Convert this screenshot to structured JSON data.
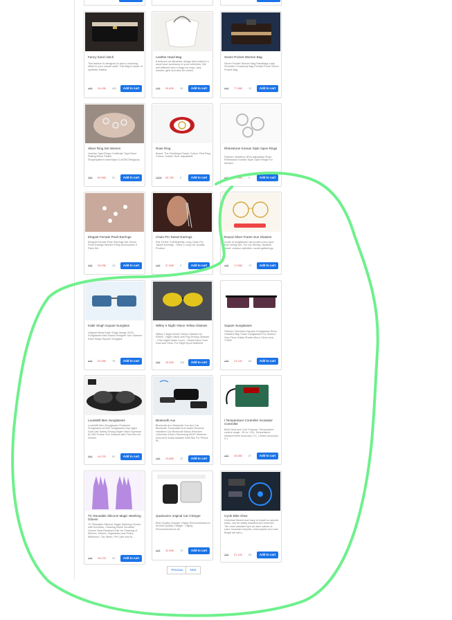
{
  "add_label": "Add to cart",
  "pagination": {
    "previous": "Previous",
    "next": "Next"
  },
  "products": [
    {
      "title": "Fancy hand clutch",
      "desc": "This fashion is designed to add a charming effect to your casual outfit. This Bag is made of synthetic leather.",
      "old": "44$",
      "new": "39.43$",
      "disc": "401"
    },
    {
      "title": "Leather Hand Bag",
      "desc": "It features an attractive design that makes it a must have accessory in your collection. We sell different kind of bags for boys, kids, women, girls and also for unisex.",
      "old": "77$",
      "new": "50.62$",
      "disc": "43"
    },
    {
      "title": "Seven Pocket Women Bag",
      "desc": "Seven Pocket Women Bag Handbags Lady Shoulder Crossbody Bag Female Purse Seven Pocket Bag",
      "old": "84$",
      "new": "77.98$",
      "disc": "13"
    },
    {
      "title": "Silver Ring Set Women",
      "desc": "Jewelry Type:Rings Certificate Type:None Plating:Silver Plated Shape\\pattern:noneStyle:CLASSICReligious",
      "old": "79$",
      "new": "60.58$",
      "disc": "51"
    },
    {
      "title": "Rose Ring",
      "desc": "Brand: The Greetings Flower Colour: Red Ring Colour: Golden Size: Adjustable",
      "old": "100$",
      "new": "96.76$",
      "disc": "9"
    },
    {
      "title": "Rhinestone Korean Style Open Rings",
      "desc": "Fashion Jewellery 3Pcs Adjustable Rose Rhinestone Korean Style Open Rings For Women",
      "old": "40$",
      "new": "27.58$",
      "disc": "9"
    },
    {
      "title": "Elegant Female Pearl Earrings",
      "desc": "Elegant Female Pearl Earrings Set Zircon Pearl Earings Women Party Accessories 9 Pairs Set",
      "old": "39$",
      "new": "26.93$",
      "disc": "16"
    },
    {
      "title": "Chain Pin Tassel Earrings",
      "desc": "Pair Of Ear Cuff Butterfly Long Chain Pin Tassel Earrings - Silver | Long Life Quality Product",
      "old": "45$",
      "new": "37.05$",
      "disc": "9"
    },
    {
      "title": "Round Silver Frame Sun Glasses",
      "desc": "A pair of sunglasses can protect your eyes from being hurt. For car driving, vacation travel, outdoor activities, social gatherings,",
      "old": "44$",
      "new": "17.98$",
      "disc": "79"
    },
    {
      "title": "Kabir Singh Square Sunglass",
      "desc": "Original Metal Kabir Singh design 2020 Sunglasses Men Brand Designer Sun Glasses Kabir Singh Square Sunglass",
      "old": "50$",
      "new": "42.28$",
      "disc": "78"
    },
    {
      "title": "Willey X Night Vision Yellow Glasses",
      "desc": "Willey X Night Vision Yellow Glasses for Riders - Night Vision Anti Fog Driving Glasses - Free Night Glass Cover - Shield Eyes From Dust and Virus- For Night Sport Matches",
      "old": "35$",
      "new": "28.30$",
      "disc": "115"
    },
    {
      "title": "Square Sunglasses",
      "desc": "Fashion Oversized Square Sunglasses Retro Gradient Big Frame Sunglasses For Women One Piece Gafas Shade Mirror Clear Lens 17059",
      "old": "28$",
      "new": "24.11$",
      "disc": "64"
    },
    {
      "title": "LouisWill Men Sunglasses",
      "desc": "LouisWill Men Sunglasses Polarized Sunglasses UV400 Sunglasses Day Night Dual Use Safety Driving Night Vision Eyewear AL-MG Frame Sun Glasses with Free Box for Drivers",
      "old": "50$",
      "new": "44.37$",
      "disc": "92"
    },
    {
      "title": "Bluetooth Aux",
      "desc": "Bluetooth Aux Bluetooth Car Aux Car Bluetooth Transmitter Aux Audio Receiver Handfree Car Bluetooth Music Receiver Universal 3.5mm Streaming A2DP Wireless Auto AUX Audio Adapter With Mic For Phone M...",
      "old": "25$",
      "new": "23.88$",
      "disc": "22"
    },
    {
      "title": "t Temperature Controller Incubator Controller",
      "desc": "Both Heat and Cool Purpose, Temperature control range: -50 to +110, Temperature measurement accuracy: 0.1, Control accuracy: 0.1",
      "old": "46$",
      "new": "35.08$",
      "disc": "57"
    },
    {
      "title": "TC Reusable Silicone Magic Washing Gloves",
      "desc": "TC Reusable Silicone Magic Washing Gloves with Scrubber, Cleaning Brush Scrubber Gloves Heat Resistant Pair for Cleaning of Kitchen, Dishes, Vegetables and Fruits, Bathroom, Car Wash, Pet Care and M...",
      "old": "29$",
      "new": "30.07$",
      "disc": "42"
    },
    {
      "title": "Qualcomm original Car Charger",
      "desc": "Best Quality Charger, Highly Recommended to all best Quality Charger , Highly Recommended to all",
      "old": "40$",
      "new": "32.99$",
      "disc": "79"
    },
    {
      "title": "Cycle Bike Glow",
      "desc": "Universal fitment and easy to install no special wires, can be easily installed and removed. Tire most standard tyre air stem valves of road, mountain bicycles, motorcycles and cars Bright led will s...",
      "old": "35$",
      "new": "31.12$",
      "disc": "63"
    }
  ],
  "icons": {
    "p0": "clutch-image",
    "p1": "leather-bag-image",
    "p2": "wallet-image",
    "p3": "ring-set-image",
    "p4": "rose-ring-image",
    "p5": "open-rings-image",
    "p6": "pearl-earrings-image",
    "p7": "tassel-earrings-image",
    "p8": "round-glasses-image",
    "p9": "square-sunglass-image",
    "p10": "yellow-glasses-image",
    "p11": "square-sunglasses-image",
    "p12": "men-sunglasses-image",
    "p13": "bluetooth-aux-image",
    "p14": "temperature-controller-image",
    "p15": "washing-gloves-image",
    "p16": "car-charger-image",
    "p17": "bike-glow-image"
  },
  "colors": {
    "accent": "#1a73e8",
    "price": "#e05050",
    "annotation": "#6ff08c"
  }
}
